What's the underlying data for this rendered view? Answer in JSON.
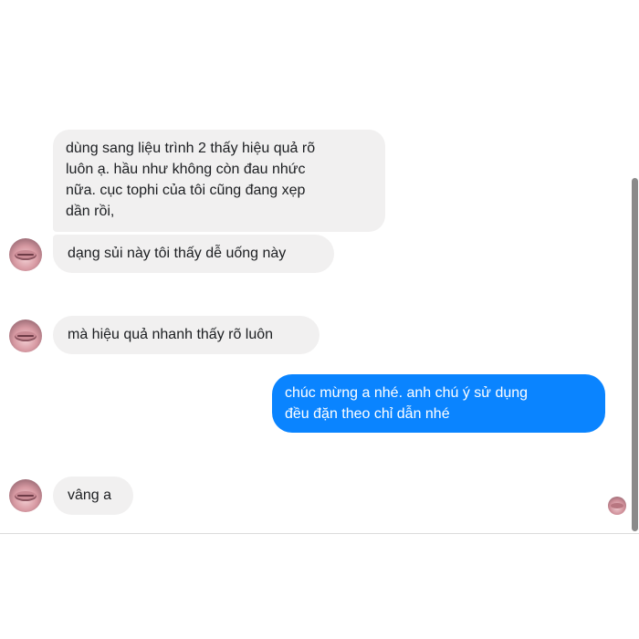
{
  "messages": [
    {
      "from": "contact",
      "lines": [
        "dùng sang liệu trình 2 thấy hiệu quả rõ",
        "luôn ạ. hầu như không còn đau nhức",
        "nữa. cục tophi của tôi cũng đang xẹp",
        "dần rồi,"
      ]
    },
    {
      "from": "contact",
      "lines": [
        "dạng sủi này tôi thấy dễ uống này"
      ]
    },
    {
      "from": "contact",
      "lines": [
        "mà hiệu quả nhanh thấy rõ luôn"
      ]
    },
    {
      "from": "me",
      "lines": [
        "chúc mừng a nhé. anh chú ý sử dụng",
        "đều đặn theo chỉ dẫn nhé"
      ]
    },
    {
      "from": "contact",
      "lines": [
        "vâng a"
      ]
    }
  ],
  "colors": {
    "incoming_bubble": "#f1f0f0",
    "outgoing_bubble": "#0a84ff",
    "incoming_text": "#1c1e21",
    "outgoing_text": "#ffffff"
  },
  "icons": {
    "contact_avatar": "avatar-icon",
    "seen_indicator": "seen-avatar-icon"
  }
}
